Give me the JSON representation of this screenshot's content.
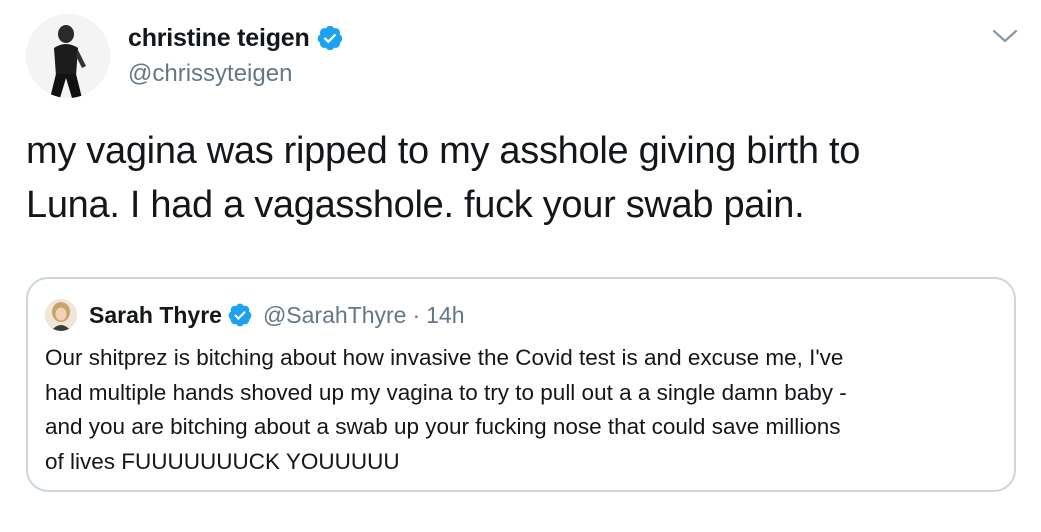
{
  "tweet": {
    "author": {
      "name": "christine teigen",
      "handle": "@chrissyteigen",
      "verified": true
    },
    "text_lines": [
      "my vagina was ripped to my asshole giving birth to",
      "Luna. I had a vagasshole. fuck your swab pain."
    ]
  },
  "quoted_tweet": {
    "author": {
      "name": "Sarah Thyre",
      "handle": "@SarahThyre",
      "verified": true
    },
    "separator": "·",
    "time": "14h",
    "text_lines": [
      "Our shitprez is bitching about how invasive the Covid test is and excuse me, I've",
      "had multiple hands shoved up my vagina to try to pull out a a single damn baby -",
      "and you are bitching about a swab up your fucking nose that could save millions",
      "of lives FUUUUUUUCK YOUUUUU"
    ]
  },
  "icons": {
    "verified": "verified-badge-icon",
    "more": "chevron-down-icon"
  },
  "colors": {
    "verified_blue": "#1da1f2",
    "secondary_text": "#657786",
    "border": "#ccd6dd"
  }
}
